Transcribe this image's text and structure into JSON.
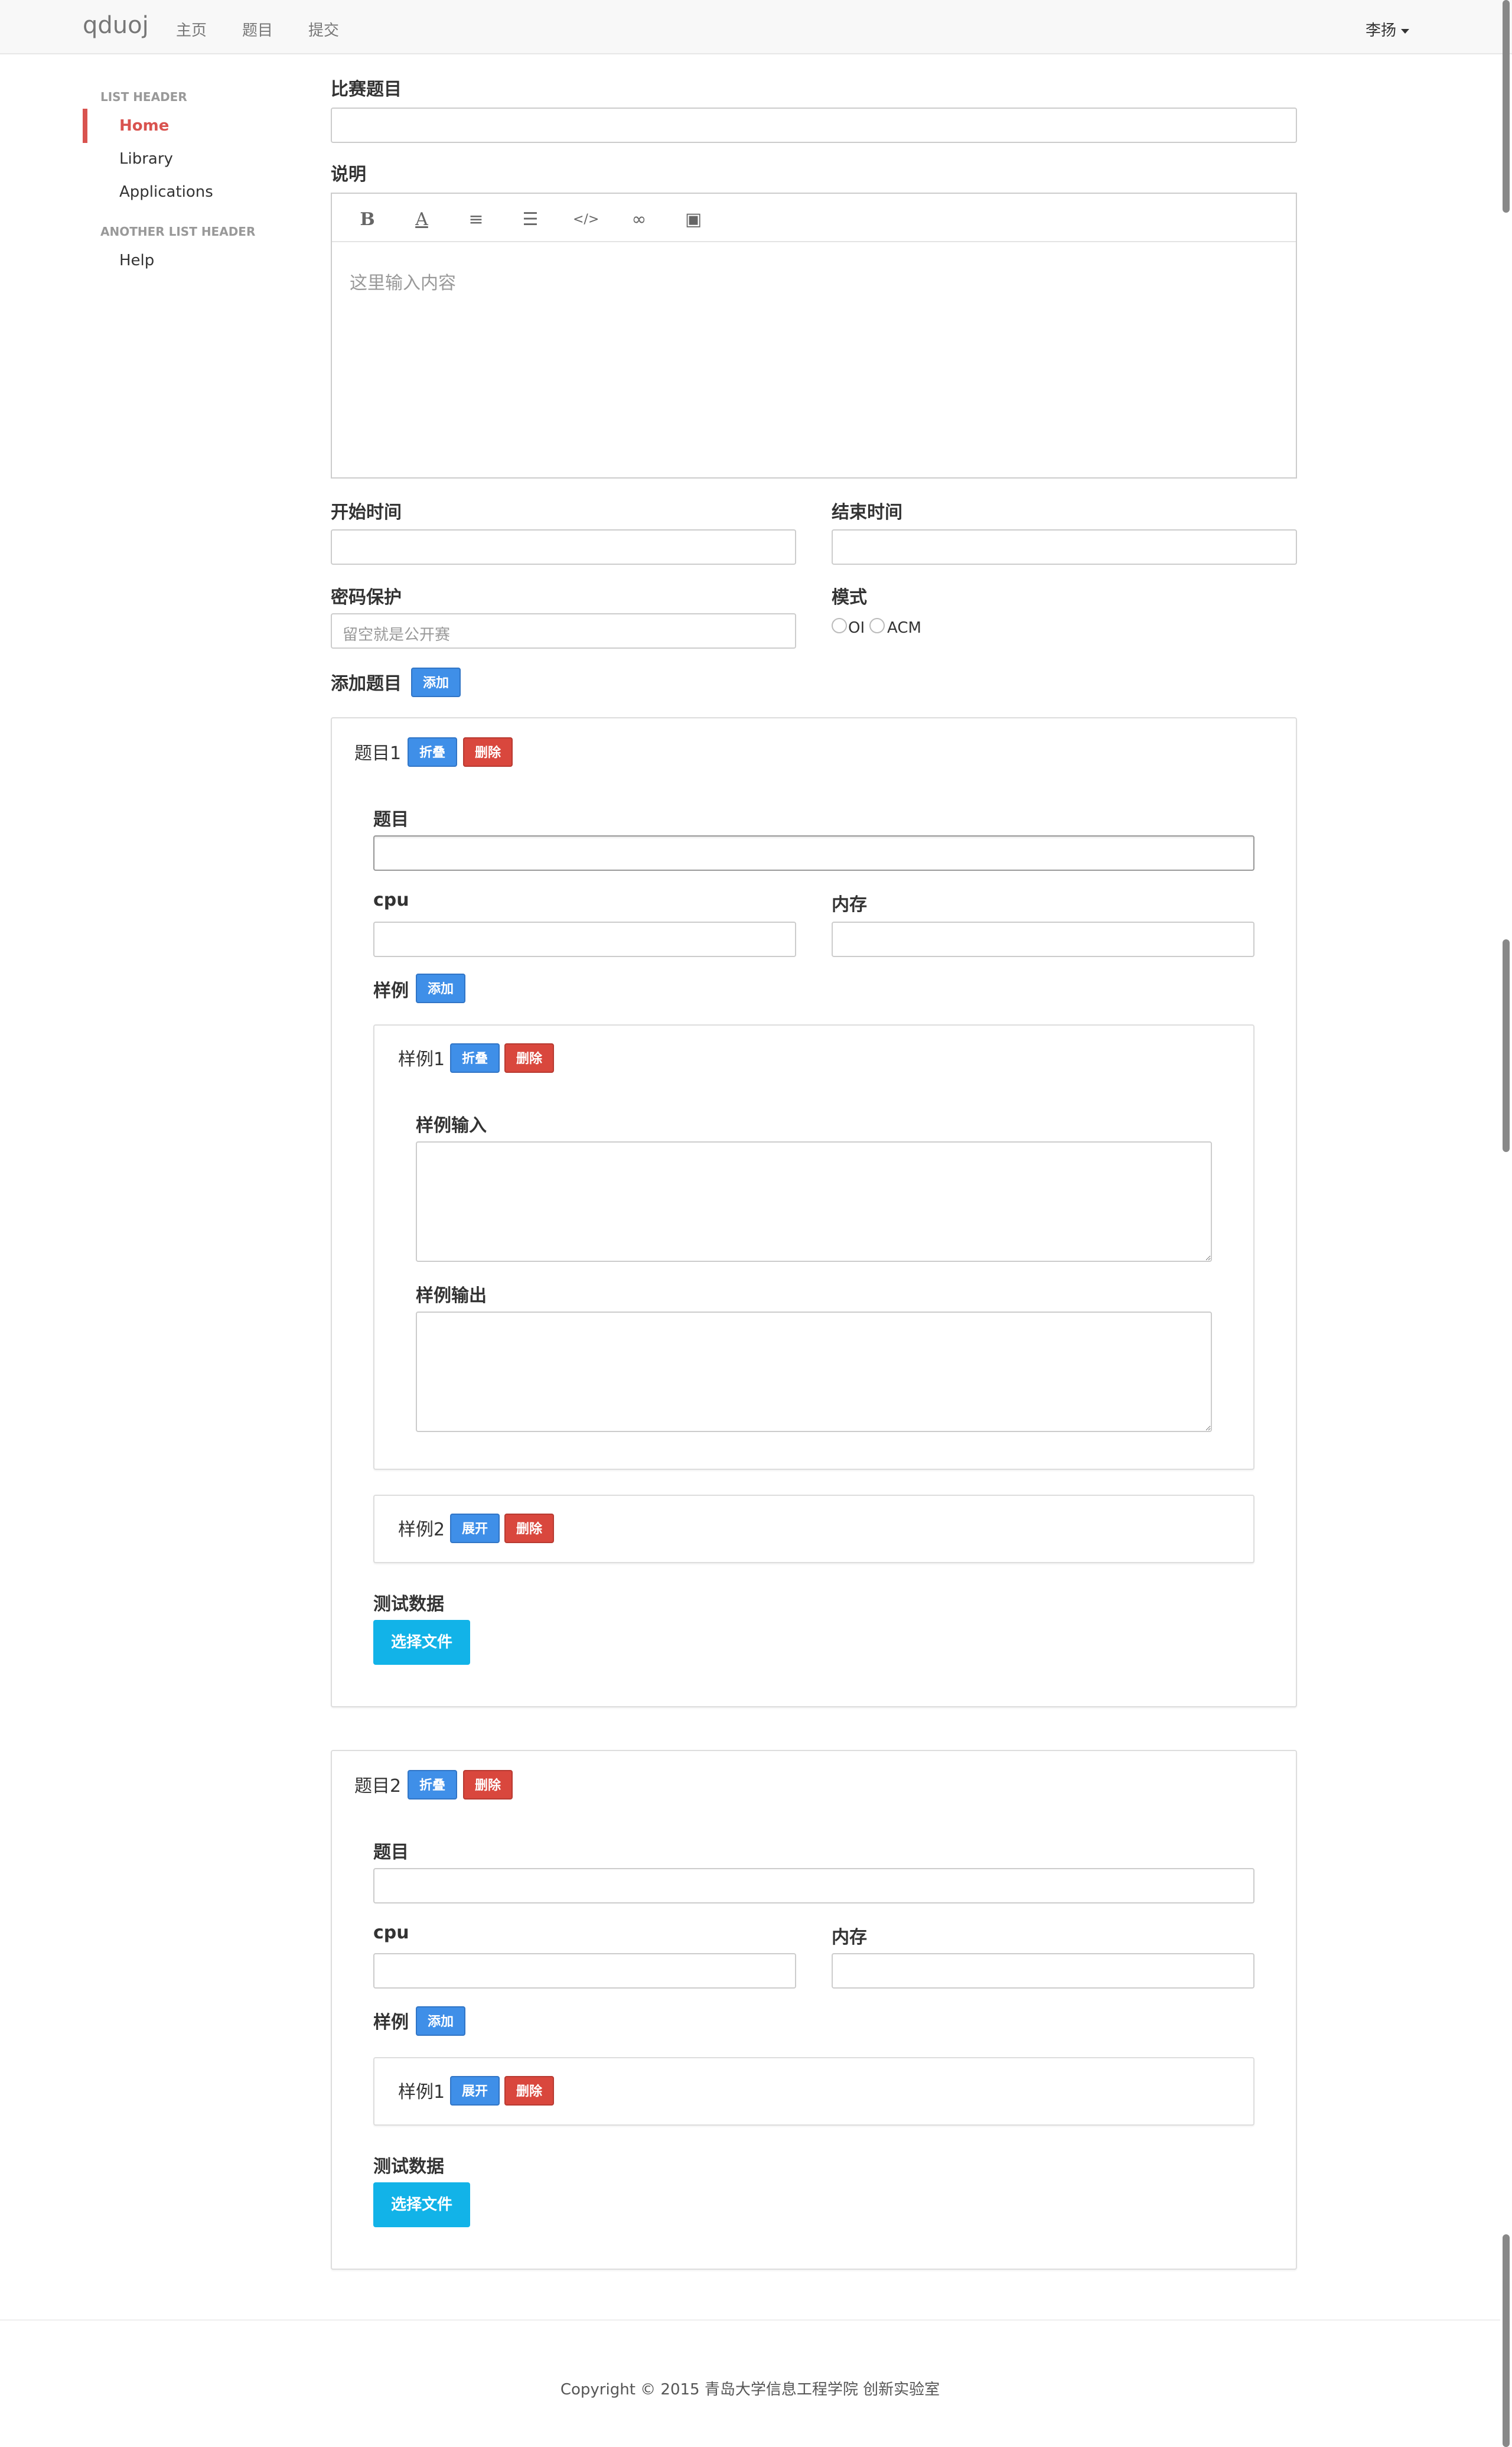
{
  "navbar": {
    "brand": "qduoj",
    "links": [
      "主页",
      "题目",
      "提交"
    ],
    "user": "李扬"
  },
  "sidebar": {
    "header1": "LIST HEADER",
    "items1": [
      "Home",
      "Library",
      "Applications"
    ],
    "header2": "ANOTHER LIST HEADER",
    "items2": [
      "Help"
    ],
    "active": "Home"
  },
  "form": {
    "contest_title_label": "比赛题目",
    "description_label": "说明",
    "editor_placeholder": "这里输入内容",
    "start_time_label": "开始时间",
    "end_time_label": "结束时间",
    "password_label": "密码保护",
    "password_placeholder": "留空就是公开赛",
    "mode_label": "模式",
    "mode_options": [
      "OI",
      "ACM"
    ],
    "add_problem_label": "添加题目",
    "add_button": "添加"
  },
  "problems": [
    {
      "title": "题目1",
      "toggle_label": "折叠",
      "delete_label": "删除",
      "problem_label": "题目",
      "cpu_label": "cpu",
      "memory_label": "内存",
      "samples_label": "样例",
      "add_sample_label": "添加",
      "samples": [
        {
          "title": "样例1",
          "toggle_label": "折叠",
          "delete_label": "删除",
          "input_label": "样例输入",
          "output_label": "样例输出"
        },
        {
          "title": "样例2",
          "toggle_label": "展开",
          "delete_label": "删除"
        }
      ],
      "test_data_label": "测试数据",
      "choose_file_label": "选择文件"
    },
    {
      "title": "题目2",
      "toggle_label": "折叠",
      "delete_label": "删除",
      "problem_label": "题目",
      "cpu_label": "cpu",
      "memory_label": "内存",
      "samples_label": "样例",
      "add_sample_label": "添加",
      "samples": [
        {
          "title": "样例1",
          "toggle_label": "展开",
          "delete_label": "删除"
        }
      ],
      "test_data_label": "测试数据",
      "choose_file_label": "选择文件"
    }
  ],
  "footer": {
    "copyright": "Copyright © 2015 青岛大学信息工程学院 创新实验室"
  },
  "colors": {
    "accent_red": "#d9534f",
    "button_blue": "#3f8fe8",
    "button_red": "#d9473d",
    "button_cyan": "#12b3e8"
  }
}
